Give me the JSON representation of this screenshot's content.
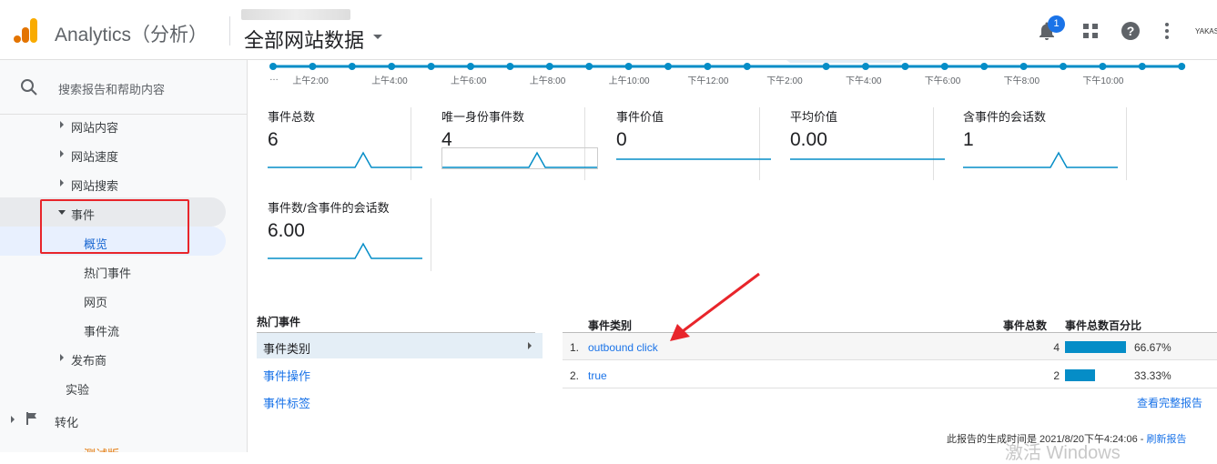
{
  "header": {
    "app_title": "Analytics（分析）",
    "view_title": "全部网站数据",
    "notification_count": "1",
    "brand": "YAKASO"
  },
  "sidebar": {
    "search_placeholder": "搜索报告和帮助内容",
    "items": [
      {
        "label": "网站内容"
      },
      {
        "label": "网站速度"
      },
      {
        "label": "网站搜索"
      },
      {
        "label": "事件"
      },
      {
        "label": "概览"
      },
      {
        "label": "热门事件"
      },
      {
        "label": "网页"
      },
      {
        "label": "事件流"
      },
      {
        "label": "发布商"
      },
      {
        "label": "实验"
      },
      {
        "label": "转化"
      },
      {
        "label": "测试版"
      }
    ]
  },
  "timeline": {
    "ticks": [
      "…",
      "上午2:00",
      "上午4:00",
      "上午6:00",
      "上午8:00",
      "上午10:00",
      "下午12:00",
      "下午2:00",
      "下午4:00",
      "下午6:00",
      "下午8:00",
      "下午10:00"
    ]
  },
  "metrics": [
    {
      "name": "事件总数",
      "value": "6"
    },
    {
      "name": "唯一身份事件数",
      "value": "4"
    },
    {
      "name": "事件价值",
      "value": "0"
    },
    {
      "name": "平均价值",
      "value": "0.00"
    },
    {
      "name": "含事件的会话数",
      "value": "1"
    },
    {
      "name": "事件数/含事件的会话数",
      "value": "6.00"
    }
  ],
  "hot_events": {
    "header": "热门事件",
    "rows": [
      {
        "label": "事件类别"
      },
      {
        "label": "事件操作"
      },
      {
        "label": "事件标签"
      }
    ]
  },
  "event_table": {
    "headers": {
      "category": "事件类别",
      "total": "事件总数",
      "percent": "事件总数百分比"
    },
    "rows": [
      {
        "num": "1.",
        "name": "outbound click",
        "count": "4",
        "percent": "66.67%",
        "share": 0.6667
      },
      {
        "num": "2.",
        "name": "true",
        "count": "2",
        "percent": "33.33%",
        "share": 0.3333
      }
    ],
    "full_report_link": "查看完整报告"
  },
  "footer": {
    "generated": "此报告的生成时间是 2021/8/20下午4:24:06 - ",
    "refresh": "刷新报告",
    "watermark": "激活 Windows"
  },
  "colors": {
    "accent": "#058dc7",
    "annotation": "#e8252b",
    "link": "#1a73e8"
  }
}
